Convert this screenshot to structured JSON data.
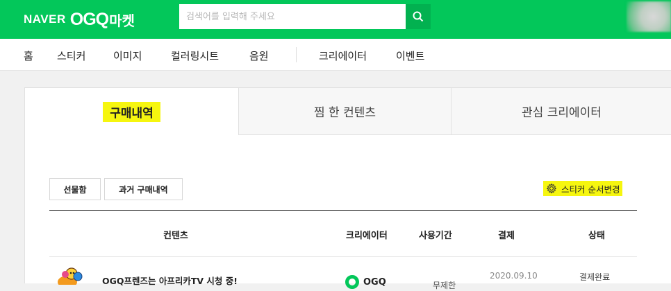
{
  "header": {
    "brand_naver": "NAVER",
    "brand_ogq": "OGQ",
    "brand_market": "마켓",
    "search_placeholder": "검색어를 입력해 주세요"
  },
  "nav": {
    "items": [
      "홈",
      "스티커",
      "이미지",
      "컬러링시트",
      "음원",
      "크리에이터",
      "이벤트"
    ]
  },
  "tabs": [
    {
      "label": "구매내역",
      "active": true
    },
    {
      "label": "찜 한 컨텐츠",
      "active": false
    },
    {
      "label": "관심 크리에이터",
      "active": false
    }
  ],
  "actions": {
    "gift_box": "선물함",
    "past_purchases": "과거 구매내역",
    "reorder_stickers": "스티커 순서변경"
  },
  "table": {
    "headers": [
      "컨텐츠",
      "크리에이터",
      "사용기간",
      "결제",
      "상태"
    ],
    "rows": [
      {
        "title": "OGQ프렌즈는 아프리카TV 시청 중!",
        "creator": "OGQ",
        "period": "무제한",
        "date": "2020.09.10",
        "status": "결제완료"
      }
    ]
  },
  "colors": {
    "brand_green": "#03c75a",
    "highlight_yellow": "#f6f60f"
  }
}
